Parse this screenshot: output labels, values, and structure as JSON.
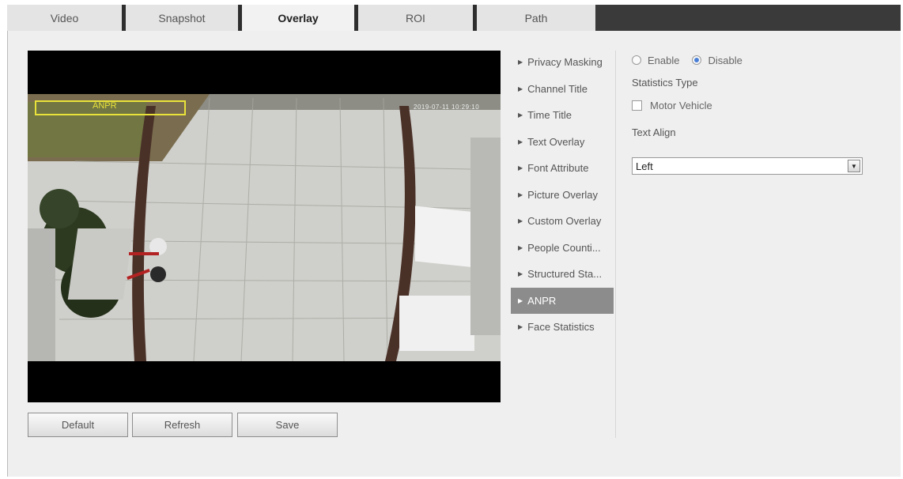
{
  "tabs": [
    "Video",
    "Snapshot",
    "Overlay",
    "ROI",
    "Path"
  ],
  "active_tab": "Overlay",
  "video": {
    "anpr_overlay_label": "ANPR",
    "time_overlay_text": "2019-07-11 10:29:10"
  },
  "buttons": {
    "default": "Default",
    "refresh": "Refresh",
    "save": "Save"
  },
  "menu": {
    "items": [
      "Privacy Masking",
      "Channel Title",
      "Time Title",
      "Text Overlay",
      "Font Attribute",
      "Picture Overlay",
      "Custom Overlay",
      "People Counti...",
      "Structured Sta...",
      "ANPR",
      "Face Statistics"
    ],
    "active": "ANPR"
  },
  "settings": {
    "enable_label": "Enable",
    "disable_label": "Disable",
    "selected": "Disable",
    "statistics_type_label": "Statistics Type",
    "motor_vehicle_label": "Motor Vehicle",
    "motor_vehicle_checked": false,
    "text_align_label": "Text Align",
    "text_align_value": "Left"
  },
  "colors": {
    "tab_bar": "#3a3a3a",
    "active_menu": "#8c8c8c",
    "overlay_box": "#e8e23a",
    "radio_selected": "#4a7fd6"
  }
}
